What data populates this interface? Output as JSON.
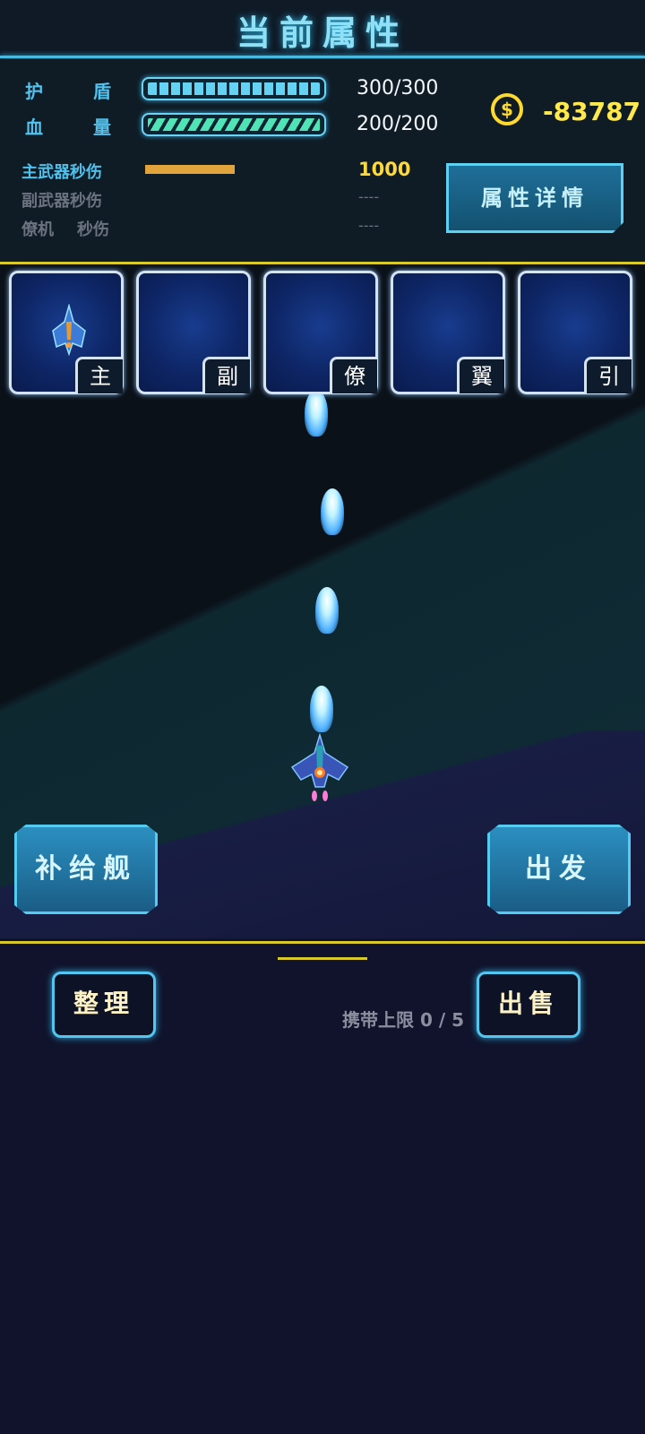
{
  "header": {
    "title": "当前属性"
  },
  "stats": {
    "shield": {
      "label_a": "护",
      "label_b": "盾",
      "current": 300,
      "max": 300,
      "text": "300/300",
      "fill_fraction": 1.0
    },
    "hp": {
      "label_a": "血",
      "label_b": "量",
      "current": 200,
      "max": 200,
      "text": "200/200",
      "fill_fraction": 1.0
    },
    "main_weapon_dps": {
      "label": "主武器秒伤",
      "value": "1000",
      "bar_fraction": 0.5
    },
    "sub_weapon_dps": {
      "label": "副武器秒伤",
      "value": "----"
    },
    "drone_dps": {
      "label_a": "僚机",
      "label_b": "秒伤",
      "value": "----"
    }
  },
  "currency": {
    "icon": "coin-icon",
    "value": "-83787"
  },
  "detail_button": {
    "label": "属性详情"
  },
  "slots": [
    {
      "tag": "主",
      "has_item": true
    },
    {
      "tag": "副",
      "has_item": false
    },
    {
      "tag": "僚",
      "has_item": false
    },
    {
      "tag": "翼",
      "has_item": false
    },
    {
      "tag": "引",
      "has_item": false
    }
  ],
  "actions": {
    "supply_ship": "补给舰",
    "depart": "出发"
  },
  "inventory": {
    "organize": "整理",
    "sell": "出售",
    "carry_limit": "携带上限 0 / 5"
  },
  "colors": {
    "accent": "#56cbf1",
    "gold": "#d9c92b",
    "coin": "#ffe94d",
    "bg": "#10132b"
  }
}
